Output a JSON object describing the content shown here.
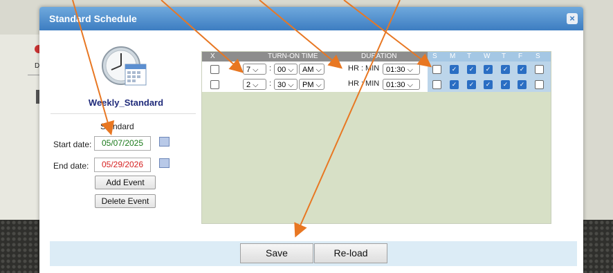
{
  "dialog": {
    "title": "Standard Schedule",
    "close_label": "×"
  },
  "left_panel": {
    "profile_name": "Weekly_Standard",
    "schedule_type": "Standard",
    "start_date_label": "Start date:",
    "start_date_value": "05/07/2025",
    "end_date_label": "End date:",
    "end_date_value": "05/29/2026",
    "add_event_label": "Add Event",
    "delete_event_label": "Delete Event"
  },
  "grid": {
    "headers": {
      "x": "X",
      "turn_on": "TURN-ON TIME",
      "duration": "DURATION",
      "days": [
        "S",
        "M",
        "T",
        "W",
        "T",
        "F",
        "S"
      ]
    },
    "rows": [
      {
        "hour": "7",
        "minute": "00",
        "ampm": "AM",
        "hrmin_label": "HR : MIN",
        "duration": "01:30",
        "days": [
          false,
          true,
          true,
          true,
          true,
          true,
          false
        ]
      },
      {
        "hour": "2",
        "minute": "30",
        "ampm": "PM",
        "hrmin_label": "HR : MIN",
        "duration": "01:30",
        "days": [
          false,
          true,
          true,
          true,
          true,
          true,
          false
        ]
      }
    ]
  },
  "footer": {
    "save_label": "Save",
    "reload_label": "Re-load"
  },
  "colors": {
    "title_bar": "#3d7dc1",
    "accent": "#2a6ec3",
    "annotation_arrow": "#e87722",
    "start_date": "#1a7a1a",
    "end_date": "#d62020"
  },
  "icons": {
    "clock": "calendar-clock-icon",
    "calendar": "calendar-icon",
    "close": "close-icon"
  }
}
